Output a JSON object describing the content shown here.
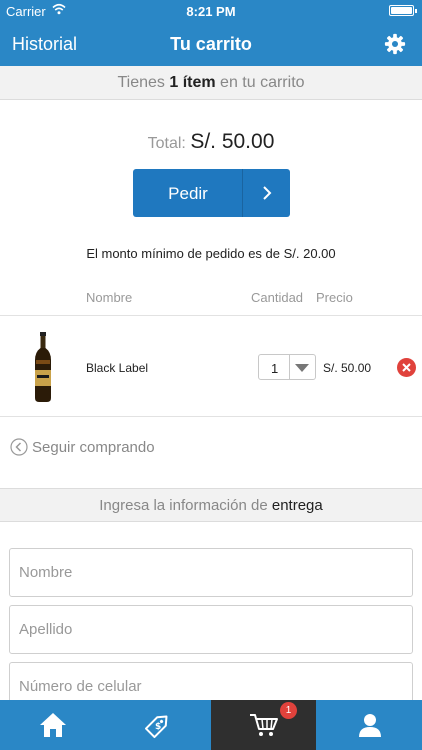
{
  "status_bar": {
    "carrier": "Carrier",
    "time": "8:21 PM"
  },
  "nav": {
    "back_label": "Historial",
    "title": "Tu carrito",
    "settings_icon": "gear-icon"
  },
  "summary": {
    "prefix": "Tienes",
    "count": "1 ítem",
    "suffix": "en tu carrito"
  },
  "total": {
    "label": "Total:",
    "amount": "S/. 50.00"
  },
  "order_button": {
    "label": "Pedir",
    "icon": "chevron-right-icon"
  },
  "min_order_note": "El monto mínimo de pedido es de S/. 20.00",
  "table": {
    "headers": {
      "name": "Nombre",
      "quantity": "Cantidad",
      "price": "Precio"
    },
    "items": [
      {
        "name": "Black Label",
        "quantity": "1",
        "price": "S/. 50.00",
        "image_icon": "whisky-bottle-icon",
        "remove_icon": "remove-icon"
      }
    ]
  },
  "continue_link": {
    "label": "Seguir comprando",
    "icon": "chevron-left-circle-icon"
  },
  "delivery": {
    "prefix": "Ingresa la información de",
    "emphasis": "entrega"
  },
  "form": {
    "first_name_placeholder": "Nombre",
    "last_name_placeholder": "Apellido",
    "phone_placeholder": "Número de celular"
  },
  "tabbar": {
    "tabs": [
      {
        "name": "home",
        "icon": "home-icon"
      },
      {
        "name": "offers",
        "icon": "price-tag-icon"
      },
      {
        "name": "cart",
        "icon": "cart-icon",
        "badge": "1",
        "active": true
      },
      {
        "name": "profile",
        "icon": "user-icon"
      }
    ]
  },
  "colors": {
    "brand": "#2a87c6",
    "button": "#1f78bf",
    "active_tab": "#2f2f2f",
    "alert": "#e0423c"
  }
}
